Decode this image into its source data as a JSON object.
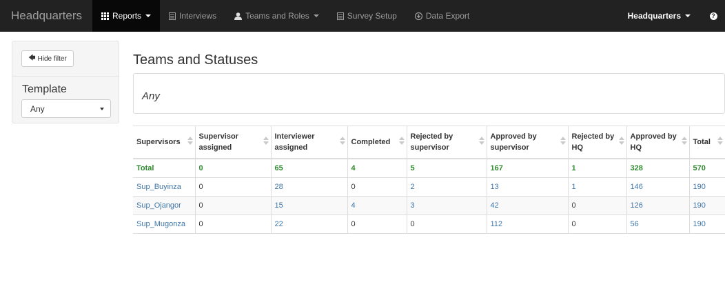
{
  "navbar": {
    "brand": "Headquarters",
    "items": [
      {
        "label": "Reports",
        "icon": "grid-icon",
        "active": true,
        "dropdown": true
      },
      {
        "label": "Interviews",
        "icon": "list-icon",
        "active": false,
        "dropdown": false
      },
      {
        "label": "Teams and Roles",
        "icon": "user-icon",
        "active": false,
        "dropdown": true
      },
      {
        "label": "Survey Setup",
        "icon": "list-icon",
        "active": false,
        "dropdown": false
      },
      {
        "label": "Data Export",
        "icon": "download-circle-icon",
        "active": false,
        "dropdown": false
      }
    ],
    "user_menu": "Headquarters",
    "help_icon": "question-icon",
    "colors": {
      "background": "#222222",
      "active": "#080808",
      "text": "#9d9d9d"
    }
  },
  "sidebar": {
    "hide_filter_label": "Hide filter",
    "template_label": "Template",
    "template_value": "Any"
  },
  "main": {
    "title": "Teams and Statuses",
    "filter_summary": "Any"
  },
  "table": {
    "headers": [
      "Supervisors",
      "Supervisor assigned",
      "Interviewer assigned",
      "Completed",
      "Rejected by supervisor",
      "Approved by supervisor",
      "Rejected by HQ",
      "Approved by HQ",
      "Total"
    ],
    "total_row": [
      "Total",
      "0",
      "65",
      "4",
      "5",
      "167",
      "1",
      "328",
      "570"
    ],
    "rows": [
      [
        "Sup_Buyinza",
        "0",
        "28",
        "0",
        "2",
        "13",
        "1",
        "146",
        "190"
      ],
      [
        "Sup_Ojangor",
        "0",
        "15",
        "4",
        "3",
        "42",
        "0",
        "126",
        "190"
      ],
      [
        "Sup_Mugonza",
        "0",
        "22",
        "0",
        "0",
        "112",
        "0",
        "56",
        "190"
      ]
    ],
    "colors": {
      "total": "#2f8a2f",
      "link": "#3f76a8"
    }
  }
}
